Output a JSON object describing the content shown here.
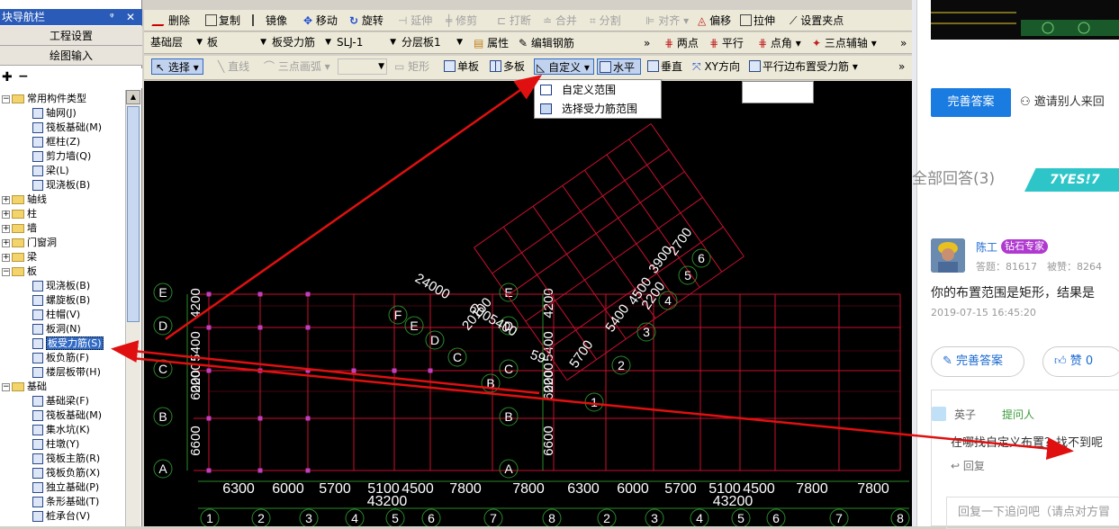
{
  "left_panel": {
    "title": "块导航栏",
    "pin": "ᵖ",
    "close": "✕",
    "btn_project": "工程设置",
    "btn_draw": "绘图输入",
    "tree": [
      {
        "type": "folder",
        "exp": "−",
        "label": "常用构件类型"
      },
      {
        "type": "item",
        "label": "轴网(J)"
      },
      {
        "type": "item",
        "label": "筏板基础(M)"
      },
      {
        "type": "item",
        "label": "框柱(Z)"
      },
      {
        "type": "item",
        "label": "剪力墙(Q)"
      },
      {
        "type": "item",
        "label": "梁(L)"
      },
      {
        "type": "item",
        "label": "现浇板(B)"
      },
      {
        "type": "folder",
        "exp": "+",
        "label": "轴线"
      },
      {
        "type": "folder",
        "exp": "+",
        "label": "柱"
      },
      {
        "type": "folder",
        "exp": "+",
        "label": "墙"
      },
      {
        "type": "folder",
        "exp": "+",
        "label": "门窗洞"
      },
      {
        "type": "folder",
        "exp": "+",
        "label": "梁"
      },
      {
        "type": "folder",
        "exp": "−",
        "label": "板"
      },
      {
        "type": "item",
        "label": "现浇板(B)"
      },
      {
        "type": "item",
        "label": "螺旋板(B)"
      },
      {
        "type": "item",
        "label": "柱帽(V)"
      },
      {
        "type": "item",
        "label": "板洞(N)"
      },
      {
        "type": "item",
        "label": "板受力筋(S)",
        "selected": true
      },
      {
        "type": "item",
        "label": "板负筋(F)"
      },
      {
        "type": "item",
        "label": "楼层板带(H)"
      },
      {
        "type": "folder",
        "exp": "−",
        "label": "基础"
      },
      {
        "type": "item",
        "label": "基础梁(F)"
      },
      {
        "type": "item",
        "label": "筏板基础(M)"
      },
      {
        "type": "item",
        "label": "集水坑(K)"
      },
      {
        "type": "item",
        "label": "柱墩(Y)"
      },
      {
        "type": "item",
        "label": "筏板主筋(R)"
      },
      {
        "type": "item",
        "label": "筏板负筋(X)"
      },
      {
        "type": "item",
        "label": "独立基础(P)"
      },
      {
        "type": "item",
        "label": "条形基础(T)"
      },
      {
        "type": "item",
        "label": "桩承台(V)"
      }
    ]
  },
  "toolbar1": {
    "delete": "删除",
    "copy": "复制",
    "mirror": "镜像",
    "move": "移动",
    "rotate": "旋转",
    "extend": "延伸",
    "trim": "修剪",
    "break": "打断",
    "merge": "合并",
    "split": "分割",
    "align": "对齐",
    "offset": "偏移",
    "stretch": "拉伸",
    "set_grip": "设置夹点"
  },
  "toolbar2": {
    "layer": "基础层",
    "type": "板",
    "sub": "板受力筋",
    "name": "SLJ-1",
    "floor": "分层板1",
    "props": "属性",
    "edit": "编辑钢筋",
    "more": "»",
    "two_point": "两点",
    "parallel": "平行",
    "point_angle": "点角",
    "three_point": "三点辅轴",
    "more2": "»"
  },
  "toolbar3": {
    "select": "选择",
    "line": "直线",
    "arc": "三点画弧",
    "rect": "矩形",
    "single": "单板",
    "multi": "多板",
    "custom": "自定义",
    "horizontal": "水平",
    "vertical": "垂直",
    "xy": "XY方向",
    "parallel_edge": "平行边布置受力筋",
    "more3": "»"
  },
  "dropdown": {
    "item1": "自定义范围",
    "item2": "选择受力筋范围"
  },
  "cad": {
    "left_rows": [
      "E",
      "D",
      "C",
      "B",
      "A"
    ],
    "right_rows": [
      "E",
      "D",
      "C",
      "B",
      "A"
    ],
    "left_vert_dims": [
      "4200",
      "5400",
      "6000",
      "2200",
      "6600"
    ],
    "right_vert_dims": [
      "4200",
      "5400",
      "6000",
      "2200",
      "6600"
    ],
    "left_bottom_dims": [
      "6300",
      "6000",
      "5700",
      "5100",
      "4500",
      "7800"
    ],
    "right_bottom_dims": [
      "7800",
      "6300",
      "6000",
      "5700",
      "5100",
      "4500",
      "7800",
      "7800"
    ],
    "left_total": "43200",
    "right_total": "43200",
    "left_cols": [
      "1",
      "2",
      "3",
      "4",
      "5",
      "6",
      "7"
    ],
    "right_cols": [
      "8",
      "2",
      "3",
      "4",
      "5",
      "6",
      "7",
      "8"
    ],
    "right_col_mid": "8",
    "rot_rows": [
      "F",
      "E",
      "D",
      "C",
      "B"
    ],
    "rot_cols": [
      "1",
      "2",
      "3",
      "4",
      "5",
      "6"
    ],
    "rot_dims1": "24000",
    "rot_dims2": "6005400",
    "rot_dims3": "20100",
    "rot_dims4": "5700",
    "rot_dims5": "5400",
    "rot_dims6": "4500",
    "rot_dims7": "3900",
    "rot_dims8": "2700",
    "rot_dims9": "2200",
    "rot_dims10": "59"
  },
  "right_panel": {
    "complete": "完善答案",
    "invite": "邀请别人来回",
    "all_answers": "全部回答(3)",
    "yes_logo": "7YES!7",
    "answer_name": "陈工",
    "answer_badge": "钻石专家",
    "answer_stats": "答题：81617　被赞：8264",
    "answer_text": "你的布置范围是矩形，结果是",
    "answer_time": "2019-07-15 16:45:20",
    "btn_complete": "完善答案",
    "btn_like": "赞 0",
    "reply_user": "英子",
    "reply_role": "提问人",
    "reply_text": "在哪找自定义布置？找不到呢",
    "reply_link": "回复",
    "reply_placeholder": "回复一下追问吧（请点对方冒"
  },
  "colors": {
    "grid": "#c8102e",
    "label_green": "#2a8a2a",
    "dim_white": "#ffffff",
    "arrow": "#e01010",
    "accent": "#1a7be0"
  }
}
